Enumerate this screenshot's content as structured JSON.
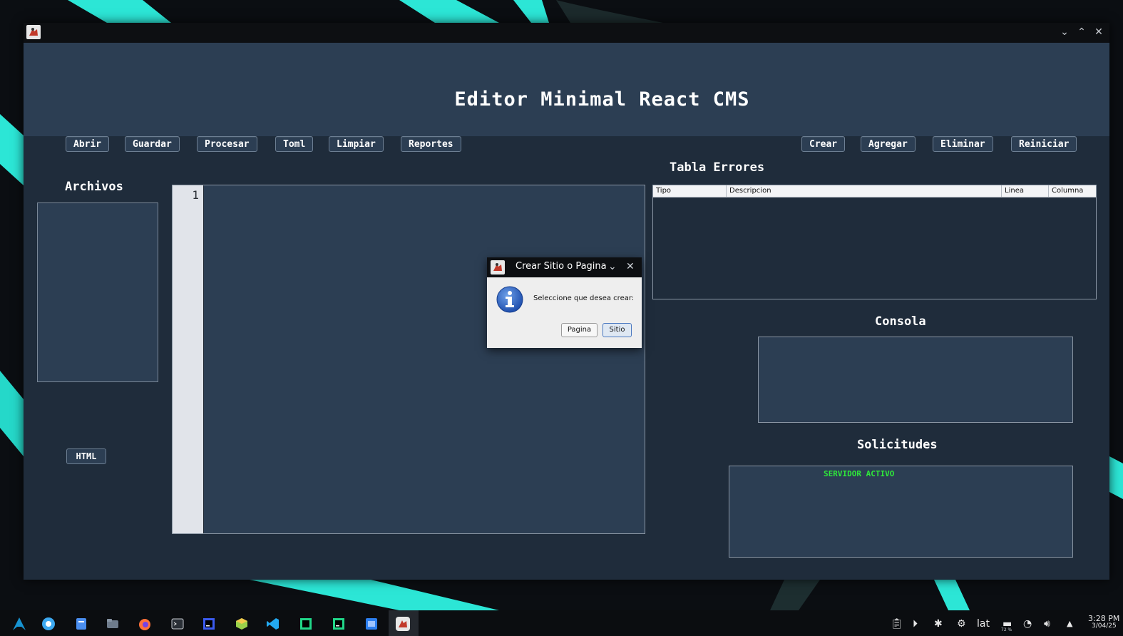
{
  "window": {
    "title": "",
    "controls": [
      "minimize-icon",
      "maximize-icon",
      "close-icon"
    ]
  },
  "header": {
    "title": "Editor Minimal React CMS",
    "left_buttons": [
      "Abrir",
      "Guardar",
      "Procesar",
      "Toml",
      "Limpiar",
      "Reportes"
    ],
    "right_buttons": [
      "Crear",
      "Agregar",
      "Eliminar",
      "Reiniciar"
    ]
  },
  "files": {
    "label": "Archivos",
    "html_button": "HTML"
  },
  "editor": {
    "line_numbers": [
      "1"
    ]
  },
  "errors": {
    "label": "Tabla Errores",
    "columns": [
      "Tipo",
      "Descripcion",
      "Linea",
      "Columna"
    ],
    "rows": []
  },
  "console": {
    "label": "Consola"
  },
  "requests": {
    "label": "Solicitudes",
    "status": "SERVIDOR ACTIVO"
  },
  "dialog": {
    "title": "Crear Sitio o Pagina",
    "message": "Seleccione que desea crear:",
    "buttons": [
      "Pagina",
      "Sitio"
    ]
  },
  "taskbar": {
    "keyboard_layout": "lat",
    "battery": "72 %",
    "time": "3:28 PM",
    "date": "3/04/25"
  },
  "colors": {
    "panel": "#2c3e53",
    "window_bg": "#1f2c3b",
    "status_green": "#2ee83a",
    "accent_teal": "#20e0d0"
  }
}
